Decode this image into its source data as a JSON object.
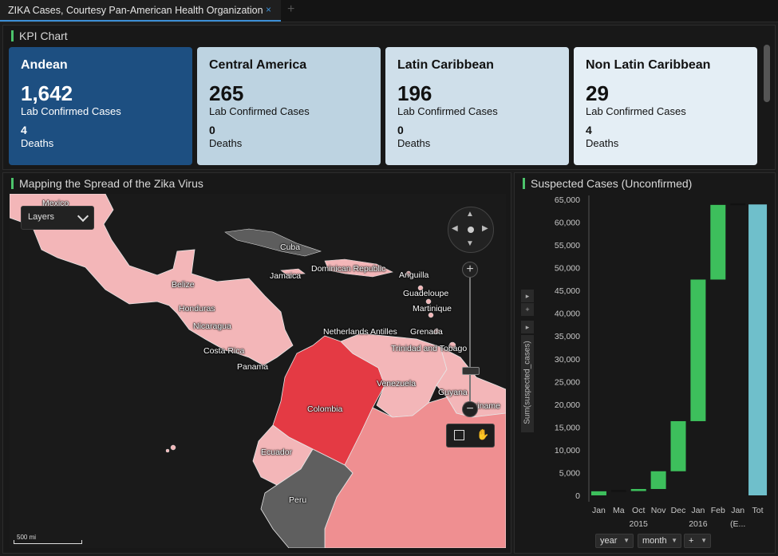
{
  "tab": {
    "title": "ZIKA Cases, Courtesy Pan-American Health Organization",
    "close_icon": "×",
    "add_icon": "+"
  },
  "kpi_panel": {
    "title": "KPI Chart",
    "cards": [
      {
        "region": "Andean",
        "cases": "1,642",
        "cases_label": "Lab Confirmed Cases",
        "deaths": "4",
        "deaths_label": "Deaths"
      },
      {
        "region": "Central America",
        "cases": "265",
        "cases_label": "Lab Confirmed Cases",
        "deaths": "0",
        "deaths_label": "Deaths"
      },
      {
        "region": "Latin Caribbean",
        "cases": "196",
        "cases_label": "Lab Confirmed Cases",
        "deaths": "0",
        "deaths_label": "Deaths"
      },
      {
        "region": "Non Latin Caribbean",
        "cases": "29",
        "cases_label": "Lab Confirmed Cases",
        "deaths": "4",
        "deaths_label": "Deaths"
      }
    ]
  },
  "map_panel": {
    "title": "Mapping the Spread of the Zika Virus",
    "layers_label": "Layers",
    "scale_label": "500 mi",
    "labels": [
      "Mexico",
      "Cuba",
      "Jamaica",
      "Dominican Republic",
      "Anguilla",
      "Guadeloupe",
      "Martinique",
      "Belize",
      "Honduras",
      "Nicaragua",
      "Costa Rica",
      "Panama",
      "Netherlands Antilles",
      "Grenada",
      "Trinidad and Tobago",
      "Venezuela",
      "Guyana",
      "Suriname",
      "Colombia",
      "Ecuador",
      "Peru"
    ]
  },
  "chart_panel": {
    "title": "Suspected Cases (Unconfirmed)",
    "y_axis_label": "Sum(suspected_cases)",
    "year_labels": [
      "2015",
      "2016"
    ],
    "controls": {
      "year": "year",
      "month": "month",
      "add": "+"
    }
  },
  "chart_data": {
    "type": "bar",
    "subtype": "waterfall",
    "categories": [
      "Jan",
      "Ma",
      "Oct",
      "Nov",
      "Dec",
      "Jan",
      "Feb",
      "Jan",
      "Tot"
    ],
    "category_labels_display": [
      "Jan",
      "Ma",
      "Oct",
      "Nov",
      "Dec",
      "Jan",
      "Feb",
      "Jan",
      "Tot"
    ],
    "extra_label": "(E...",
    "groups": [
      {
        "year": "2015",
        "months": [
          "Jan",
          "Ma",
          "Oct",
          "Nov",
          "Dec"
        ]
      },
      {
        "year": "2016",
        "months": [
          "Jan",
          "Feb"
        ]
      }
    ],
    "steps": [
      {
        "category": "Jan",
        "start": 0,
        "end": 900
      },
      {
        "category": "Ma",
        "start": 900,
        "end": 950
      },
      {
        "category": "Oct",
        "start": 950,
        "end": 1400
      },
      {
        "category": "Nov",
        "start": 1400,
        "end": 5300
      },
      {
        "category": "Dec",
        "start": 5300,
        "end": 16300
      },
      {
        "category": "Jan",
        "start": 16300,
        "end": 47400
      },
      {
        "category": "Feb",
        "start": 47400,
        "end": 63800
      },
      {
        "category": "Jan",
        "start": 63800,
        "end": 63900
      }
    ],
    "total": 63900,
    "ylim": [
      0,
      65000
    ],
    "yticks": [
      0,
      5000,
      10000,
      15000,
      20000,
      25000,
      30000,
      35000,
      40000,
      45000,
      50000,
      55000,
      60000,
      65000
    ],
    "colors": {
      "increase": "#3dbf5c",
      "total": "#6fbfcb"
    }
  }
}
